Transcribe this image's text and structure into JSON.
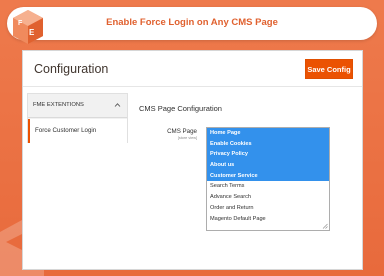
{
  "header": {
    "title": "Enable Force Login on Any CMS Page",
    "logo_icon": "fme-logo-icon"
  },
  "page": {
    "title": "Configuration",
    "save_label": "Save Config"
  },
  "sidebar": {
    "section_label": "FME EXTENTIONS",
    "items": [
      {
        "label": "Force Customer Login",
        "active": true
      }
    ]
  },
  "section": {
    "title": "CMS Page Configuration",
    "field_label": "CMS Page",
    "field_scope": "[store view]",
    "options": [
      {
        "label": "Home Page",
        "selected": true
      },
      {
        "label": "Enable Cookies",
        "selected": true
      },
      {
        "label": "Privacy Policy",
        "selected": true
      },
      {
        "label": "About us",
        "selected": true
      },
      {
        "label": "Customer Service",
        "selected": true
      },
      {
        "label": "Search Terms",
        "selected": false
      },
      {
        "label": "Advance Search",
        "selected": false
      },
      {
        "label": "Order and Return",
        "selected": false
      },
      {
        "label": "Magento Default Page",
        "selected": false
      }
    ]
  },
  "colors": {
    "background": "#e86a3c",
    "accent": "#eb5202",
    "title_text": "#e0612f",
    "selected_option": "#3391ec"
  }
}
